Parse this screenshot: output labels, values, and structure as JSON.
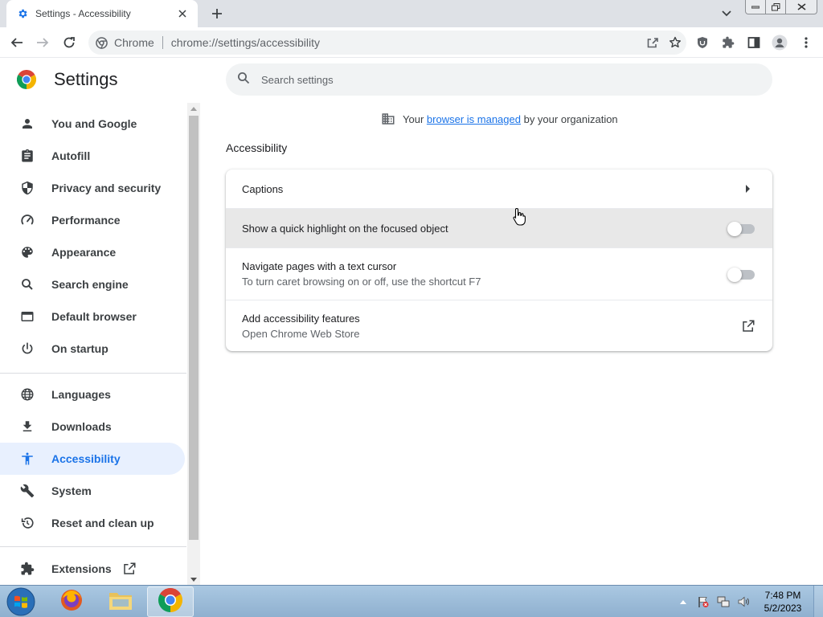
{
  "browser": {
    "tab_title": "Settings - Accessibility",
    "omnibox_chip": "Chrome",
    "url": "chrome://settings/accessibility"
  },
  "settings": {
    "title": "Settings",
    "search_placeholder": "Search settings",
    "managed": {
      "prefix": "Your",
      "link": "browser is managed",
      "suffix": "by your organization"
    }
  },
  "sidebar": {
    "items": [
      {
        "label": "You and Google",
        "icon": "person-icon"
      },
      {
        "label": "Autofill",
        "icon": "clipboard-icon"
      },
      {
        "label": "Privacy and security",
        "icon": "shield-icon"
      },
      {
        "label": "Performance",
        "icon": "speedometer-icon"
      },
      {
        "label": "Appearance",
        "icon": "palette-icon"
      },
      {
        "label": "Search engine",
        "icon": "search-icon"
      },
      {
        "label": "Default browser",
        "icon": "browser-window-icon"
      },
      {
        "label": "On startup",
        "icon": "power-icon"
      },
      {
        "label": "Languages",
        "icon": "globe-icon"
      },
      {
        "label": "Downloads",
        "icon": "download-icon"
      },
      {
        "label": "Accessibility",
        "icon": "accessibility-icon",
        "active": true
      },
      {
        "label": "System",
        "icon": "wrench-icon"
      },
      {
        "label": "Reset and clean up",
        "icon": "history-icon"
      },
      {
        "label": "Extensions",
        "icon": "puzzle-icon"
      }
    ]
  },
  "main": {
    "section_title": "Accessibility",
    "rows": [
      {
        "label": "Captions",
        "control": "arrow-right-icon"
      },
      {
        "label": "Show a quick highlight on the focused object",
        "control": "toggle",
        "state": "off"
      },
      {
        "label": "Navigate pages with a text cursor",
        "sub": "To turn caret browsing on or off, use the shortcut F7",
        "control": "toggle",
        "state": "off"
      },
      {
        "label": "Add accessibility features",
        "sub": "Open Chrome Web Store",
        "control": "open-in-new-icon"
      }
    ]
  },
  "taskbar": {
    "time": "7:48 PM",
    "date": "5/2/2023",
    "apps": [
      "firefox-icon",
      "file-explorer-icon",
      "chrome-icon"
    ]
  },
  "colors": {
    "accent": "#1a73e8",
    "active_nav_bg": "#e8f0fe",
    "tab_strip": "#dee1e6"
  }
}
